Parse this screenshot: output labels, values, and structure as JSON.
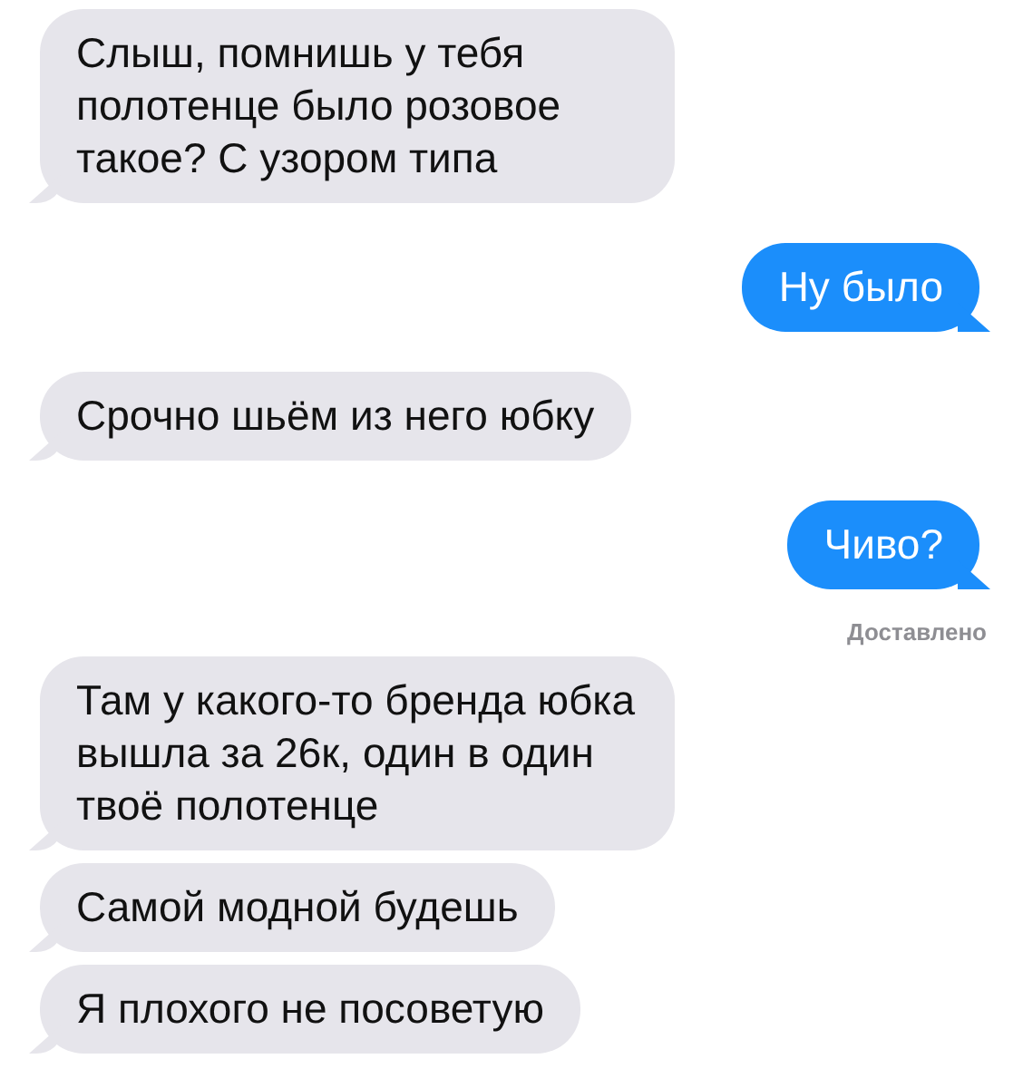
{
  "messages": [
    {
      "kind": "received",
      "text": "Слыш, помнишь у тебя полотенце было розовое такое? С узором типа"
    },
    {
      "kind": "sent",
      "text": "Ну было"
    },
    {
      "kind": "received",
      "text": "Срочно шьём из него юбку"
    },
    {
      "kind": "sent",
      "text": "Чиво?"
    },
    {
      "kind": "status",
      "text": "Доставлено"
    },
    {
      "kind": "received",
      "text": "Там у какого-то бренда юбка вышла за 26к, один в один твоё полотенце"
    },
    {
      "kind": "received",
      "text": "Самой модной будешь"
    },
    {
      "kind": "received",
      "text": "Я плохого не посоветую"
    }
  ]
}
